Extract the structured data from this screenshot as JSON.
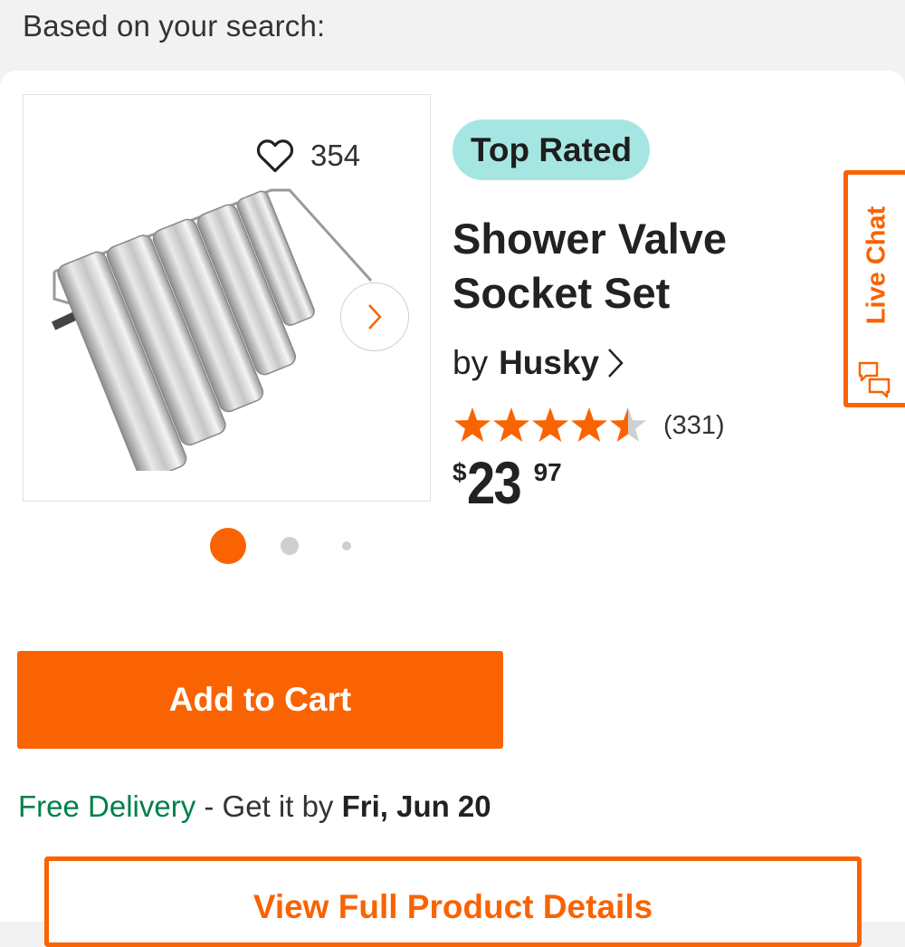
{
  "search_note": "Based on your search:",
  "product": {
    "badge": "Top Rated",
    "title": "Shower Valve Socket Set",
    "brand_prefix": "by",
    "brand": "Husky",
    "favorite_count": "354",
    "rating": 4.5,
    "review_count": "(331)",
    "price": {
      "currency": "$",
      "dollars": "23",
      "cents": "97"
    },
    "image_count": 3,
    "active_image": 0
  },
  "live_chat": {
    "label": "Live Chat"
  },
  "actions": {
    "add_to_cart": "Add to Cart",
    "view_details": "View Full Product Details"
  },
  "delivery": {
    "free": "Free Delivery",
    "middle": " - Get it by ",
    "date": "Fri, Jun 20"
  },
  "colors": {
    "accent": "#f96302",
    "badge_bg": "#a6e6e2",
    "delivery_green": "#00804a"
  },
  "icons": [
    "heart-icon",
    "chevron-right-icon",
    "star-icon",
    "chat-bubbles-icon"
  ]
}
